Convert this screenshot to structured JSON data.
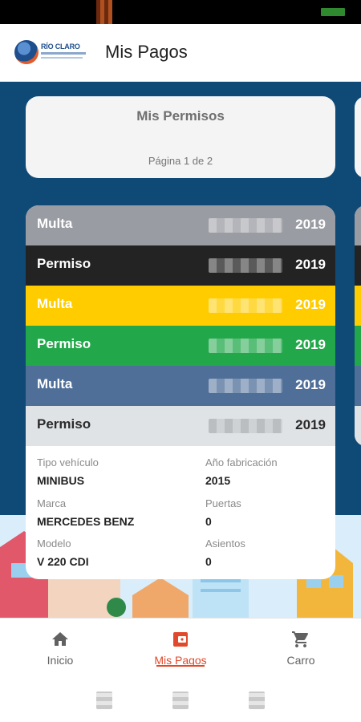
{
  "app": {
    "title": "Mis Pagos",
    "logo_text": "RÍO CLARO"
  },
  "colors": {
    "accent": "#e0492b",
    "background_blue": "#0e4a75",
    "multa_gray": "#9a9ca3",
    "permiso_black": "#232323",
    "yellow": "#ffcc00",
    "green": "#22a84a",
    "steel_blue": "#4f6f99",
    "light_gray": "#dfe3e6"
  },
  "summary_card": {
    "title": "Mis Permisos",
    "page_indicator": "Página 1 de 2"
  },
  "payments": [
    {
      "type": "Multa",
      "year": "2019",
      "bg": "#9a9ca3",
      "fg": "#ffffff"
    },
    {
      "type": "Permiso",
      "year": "2019",
      "bg": "#232323",
      "fg": "#ffffff"
    },
    {
      "type": "Multa",
      "year": "2019",
      "bg": "#ffcc00",
      "fg": "#ffffff"
    },
    {
      "type": "Permiso",
      "year": "2019",
      "bg": "#22a84a",
      "fg": "#ffffff"
    },
    {
      "type": "Multa",
      "year": "2019",
      "bg": "#4f6f99",
      "fg": "#ffffff"
    },
    {
      "type": "Permiso",
      "year": "2019",
      "bg": "#dfe3e6",
      "fg": "#2a2a2a"
    }
  ],
  "vehicle": {
    "tipo_label": "Tipo vehículo",
    "tipo_value": "MINIBUS",
    "anio_label": "Año fabricación",
    "anio_value": "2015",
    "marca_label": "Marca",
    "marca_value": "MERCEDES BENZ",
    "puertas_label": "Puertas",
    "puertas_value": "0",
    "modelo_label": "Modelo",
    "modelo_value": "V 220 CDI",
    "asientos_label": "Asientos",
    "asientos_value": "0"
  },
  "bottom_nav": {
    "home_label": "Inicio",
    "payments_label": "Mis Pagos",
    "cart_label": "Carro",
    "home_icon": "home-icon",
    "payments_icon": "wallet-icon",
    "cart_icon": "cart-icon"
  }
}
